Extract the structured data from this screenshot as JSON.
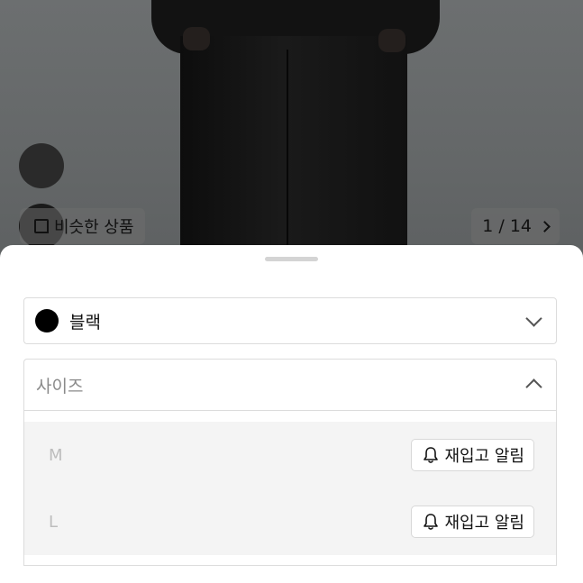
{
  "gallery": {
    "similar_products_label": "비슷한 상품",
    "page_current": "1",
    "page_total": "14",
    "page_indicator": "1 / 14"
  },
  "options": {
    "color": {
      "selected_label": "블랙",
      "swatch_color": "#000000",
      "icon": "chevron-down-icon"
    },
    "size": {
      "placeholder": "사이즈",
      "icon": "chevron-up-icon",
      "items": [
        {
          "name": "M",
          "action_label": "재입고 알림",
          "action_icon": "bell-icon"
        },
        {
          "name": "L",
          "action_label": "재입고 알림",
          "action_icon": "bell-icon"
        }
      ]
    }
  }
}
